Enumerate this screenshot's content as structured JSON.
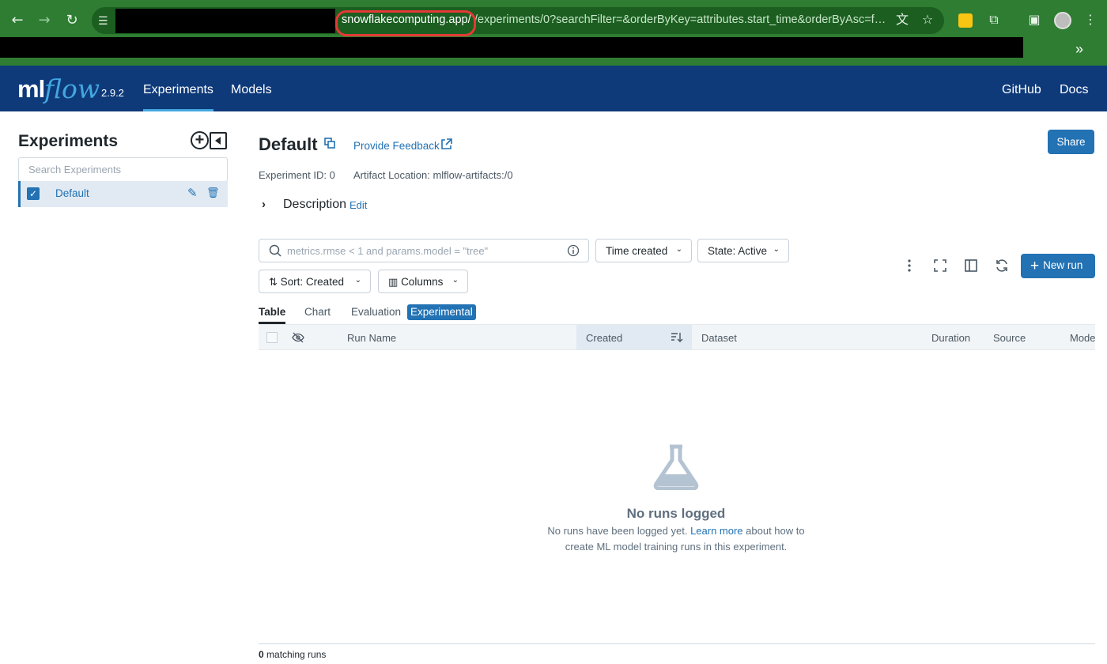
{
  "browser": {
    "url_host": "snowflakecomputing.app/",
    "url_rest": "/experiments/0?searchFilter=&orderByKey=attributes.start_time&orderByAsc=f…"
  },
  "app": {
    "logo_ml": "ml",
    "logo_flow": "flow",
    "version": "2.9.2",
    "nav": [
      "Experiments",
      "Models"
    ],
    "nav_right": [
      "GitHub",
      "Docs"
    ]
  },
  "sidebar": {
    "title": "Experiments",
    "search_placeholder": "Search Experiments",
    "items": [
      {
        "label": "Default",
        "checked": true
      }
    ]
  },
  "experiment": {
    "title": "Default",
    "feedback_label": "Provide Feedback",
    "share_label": "Share",
    "id_label": "Experiment ID: 0",
    "artifact_label": "Artifact Location: mlflow-artifacts:/0",
    "description_label": "Description",
    "description_edit": "Edit"
  },
  "controls": {
    "search_placeholder": "metrics.rmse < 1 and params.model = \"tree\"",
    "time_filter": "Time created",
    "state_filter": "State: Active",
    "sort": "Sort: Created",
    "columns": "Columns",
    "new_run": "New run"
  },
  "tabs": [
    "Table",
    "Chart",
    "Evaluation",
    "Experimental"
  ],
  "table": {
    "columns": [
      "Run Name",
      "Created",
      "Dataset",
      "Duration",
      "Source",
      "Mode"
    ]
  },
  "empty_state": {
    "title": "No runs logged",
    "text_before": "No runs have been logged yet. ",
    "link": "Learn more",
    "text_after": " about how to create ML model training runs in this experiment."
  },
  "footer": {
    "count": "0",
    "label": " matching runs"
  },
  "colors": {
    "brand_header": "#0e3a7a",
    "primary": "#2272b4",
    "browser_frame": "#2e7d32",
    "highlight_circle": "#e53935"
  }
}
